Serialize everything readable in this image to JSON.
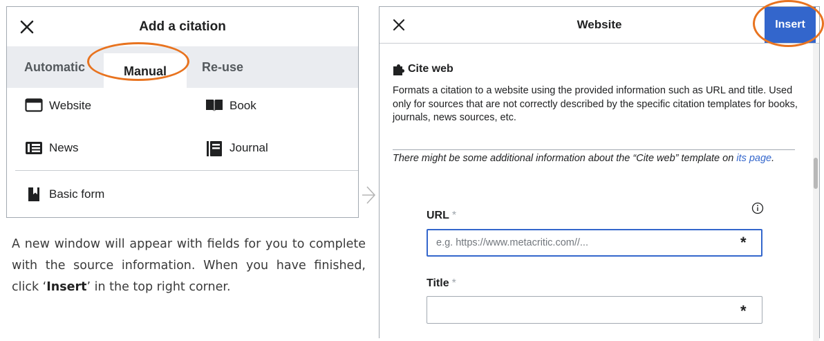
{
  "left_dialog": {
    "title": "Add a citation",
    "close_icon": "close-icon",
    "tabs": [
      {
        "label": "Automatic"
      },
      {
        "label": "Manual",
        "selected": true
      },
      {
        "label": "Re-use"
      }
    ],
    "options": {
      "website": {
        "label": "Website",
        "icon": "browser-window-icon"
      },
      "book": {
        "label": "Book",
        "icon": "book-icon"
      },
      "news": {
        "label": "News",
        "icon": "newspaper-icon"
      },
      "journal": {
        "label": "Journal",
        "icon": "journal-icon"
      },
      "basic": {
        "label": "Basic form",
        "icon": "bookmark-book-icon"
      }
    }
  },
  "instruction": {
    "before": "A new window will appear with fields for you to complete with the source information. When you have finished, click ‘",
    "bold": "Insert",
    "after": "’ in the top right corner."
  },
  "right_dialog": {
    "title": "Website",
    "insert_label": "Insert",
    "template_name": "Cite web",
    "description": "Formats a citation to a website using the provided information such as URL and title. Used only for sources that are not correctly described by the specific citation templates for books, journals, news sources, etc.",
    "note_before": "There might be some additional information about the “Cite web” template on ",
    "note_link": "its page",
    "note_after": ".",
    "fields": {
      "url": {
        "label": "URL",
        "placeholder": "e.g. https://www.metacritic.com//...",
        "value": "",
        "required_mark": "*"
      },
      "title": {
        "label": "Title",
        "placeholder": "",
        "value": "",
        "required_mark": "*"
      }
    }
  },
  "colors": {
    "accent": "#3366cc",
    "highlight_ring": "#e8731f",
    "tab_bar": "#eaecf0",
    "border": "#a2a9b1"
  }
}
